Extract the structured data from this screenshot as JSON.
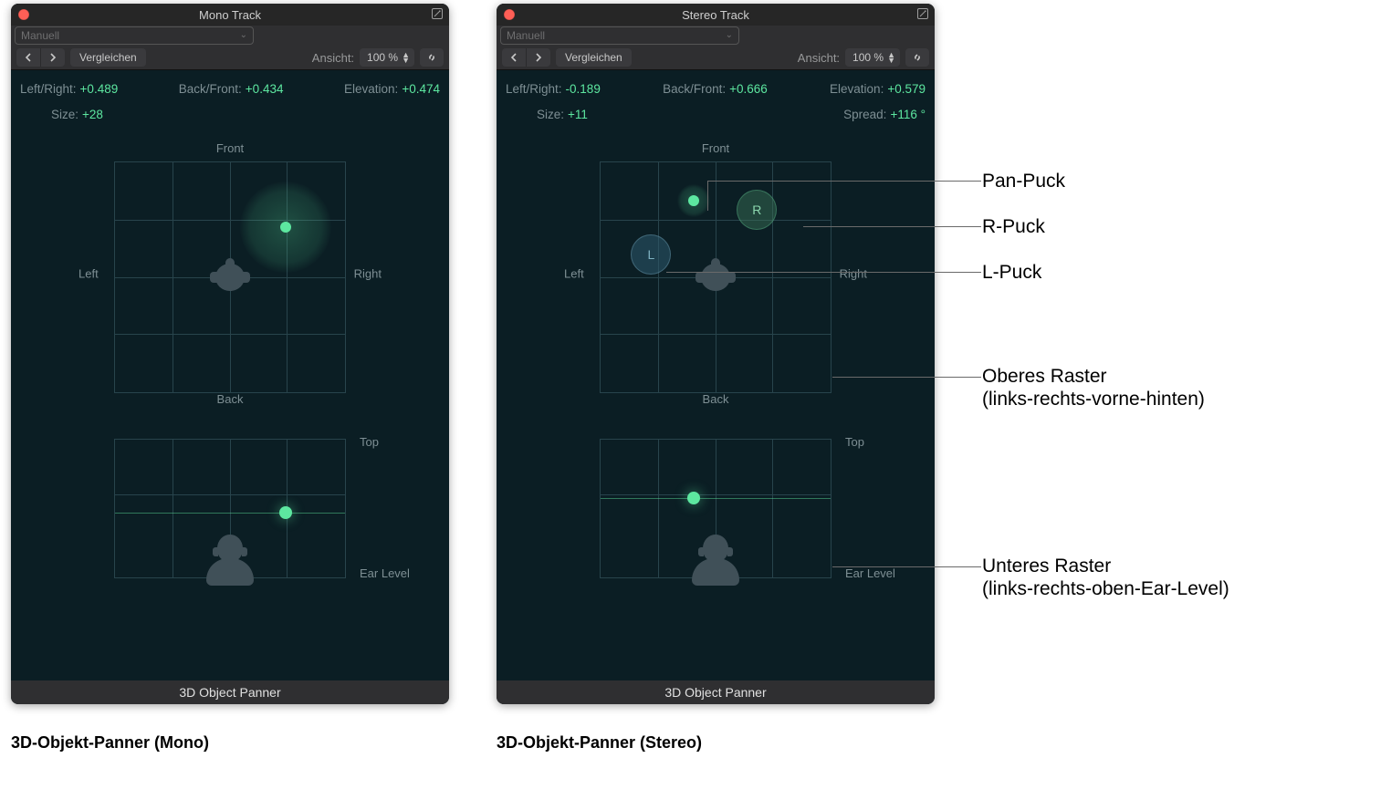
{
  "mono": {
    "title": "Mono Track",
    "preset": "Manuell",
    "compare": "Vergleichen",
    "view_label": "Ansicht:",
    "zoom": "100 %",
    "readouts": {
      "lr_label": "Left/Right:",
      "lr_value": "+0.489",
      "bf_label": "Back/Front:",
      "bf_value": "+0.434",
      "el_label": "Elevation:",
      "el_value": "+0.474",
      "sz_label": "Size:",
      "sz_value": "+28"
    },
    "upper_grid": {
      "front": "Front",
      "back": "Back",
      "left": "Left",
      "right": "Right",
      "puck_x": 0.744,
      "puck_y": 0.28,
      "halo": "lg"
    },
    "lower_grid": {
      "top": "Top",
      "ear": "Ear Level",
      "puck_x": 0.744,
      "elev": 0.474
    },
    "footer": "3D Object Panner",
    "caption": "3D-Objekt-Panner (Mono)"
  },
  "stereo": {
    "title": "Stereo Track",
    "preset": "Manuell",
    "compare": "Vergleichen",
    "view_label": "Ansicht:",
    "zoom": "100 %",
    "readouts": {
      "lr_label": "Left/Right:",
      "lr_value": "-0.189",
      "bf_label": "Back/Front:",
      "bf_value": "+0.666",
      "el_label": "Elevation:",
      "el_value": "+0.579",
      "sz_label": "Size:",
      "sz_value": "+11",
      "sp_label": "Spread:",
      "sp_value": "+116 °"
    },
    "upper_grid": {
      "front": "Front",
      "back": "Back",
      "left": "Left",
      "right": "Right",
      "puck_x": 0.405,
      "puck_y": 0.165,
      "halo": "sm",
      "L_x": 0.22,
      "L_y": 0.4,
      "R_x": 0.68,
      "R_y": 0.205
    },
    "lower_grid": {
      "top": "Top",
      "ear": "Ear Level",
      "puck_x": 0.405,
      "elev": 0.579
    },
    "footer": "3D Object Panner",
    "caption": "3D-Objekt-Panner (Stereo)"
  },
  "callouts": {
    "pan": "Pan-Puck",
    "r": "R-Puck",
    "l": "L-Puck",
    "upper1": "Oberes Raster",
    "upper2": "(links-rechts-vorne-hinten)",
    "lower1": "Unteres Raster",
    "lower2": "(links-rechts-oben-Ear-Level)"
  }
}
